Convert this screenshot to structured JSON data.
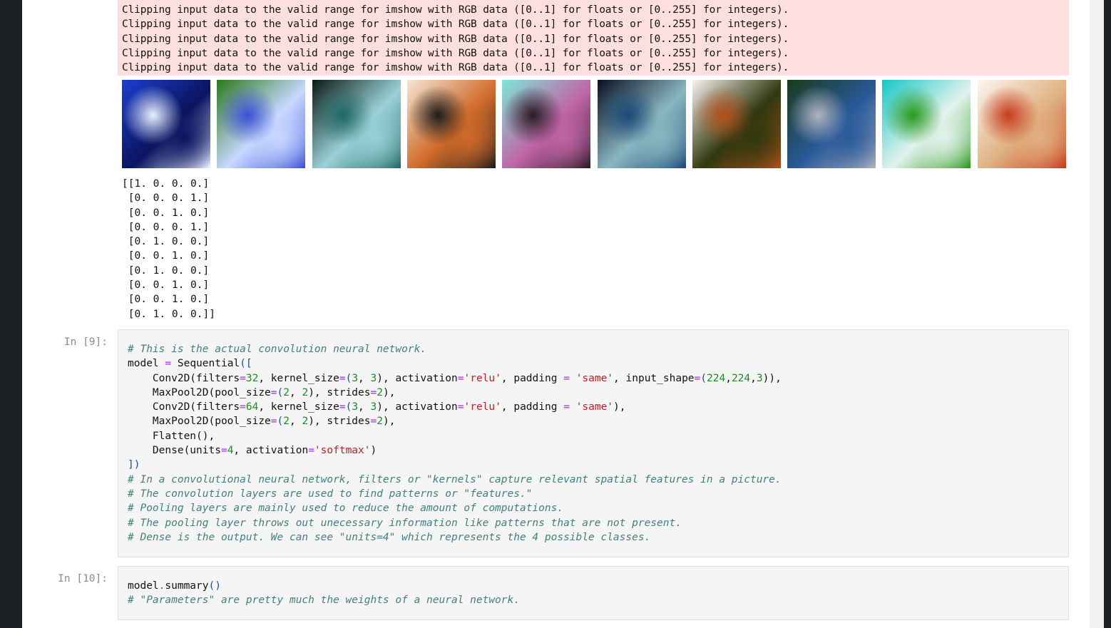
{
  "stderr": {
    "lines": [
      "Clipping input data to the valid range for imshow with RGB data ([0..1] for floats or [0..255] for integers).",
      "Clipping input data to the valid range for imshow with RGB data ([0..1] for floats or [0..255] for integers).",
      "Clipping input data to the valid range for imshow with RGB data ([0..1] for floats or [0..255] for integers).",
      "Clipping input data to the valid range for imshow with RGB data ([0..1] for floats or [0..255] for integers).",
      "Clipping input data to the valid range for imshow with RGB data ([0..1] for floats or [0..255] for integers)."
    ]
  },
  "thumbnails": {
    "count": 10,
    "colors": [
      [
        "#1d3fd0",
        "#e8f0ff",
        "#0a1460"
      ],
      [
        "#2b7a1a",
        "#3a50d8",
        "#c8d8ff"
      ],
      [
        "#0b1a14",
        "#1f6a66",
        "#9ad0d6"
      ],
      [
        "#f4e6d4",
        "#1c1c1c",
        "#d06a2a"
      ],
      [
        "#7de7d8",
        "#2a1a22",
        "#c064a6"
      ],
      [
        "#0a0f20",
        "#1a4a7a",
        "#8ab6c0"
      ],
      [
        "#f6f2ee",
        "#b4501a",
        "#30380f"
      ],
      [
        "#1a3a1a",
        "#b0b4c0",
        "#2a5a9a"
      ],
      [
        "#14c8c8",
        "#2a9a1a",
        "#e2f2ec"
      ],
      [
        "#fbf6f2",
        "#c83a1a",
        "#e0b080"
      ]
    ]
  },
  "labels_output": "[[1. 0. 0. 0.]\n [0. 0. 0. 1.]\n [0. 0. 1. 0.]\n [0. 0. 0. 1.]\n [0. 1. 0. 0.]\n [0. 0. 1. 0.]\n [0. 1. 0. 0.]\n [0. 0. 1. 0.]\n [0. 0. 1. 0.]\n [0. 1. 0. 0.]]",
  "cells": [
    {
      "prompt": "In [9]:",
      "comment_1": "# This is the actual convolution neural network.",
      "t_model": "model",
      "t_eq": "=",
      "t_seq": "Sequential",
      "t_open": "([",
      "l1_a": "    Conv2D(filters",
      "l1_eq": "=",
      "l1_n1": "32",
      "l1_b": ", kernel_size",
      "l1_eq2": "=",
      "l1_c": "(",
      "l1_n2": "3",
      "l1_d": ", ",
      "l1_n3": "3",
      "l1_e": "), activation",
      "l1_eq3": "=",
      "l1_s1": "'relu'",
      "l1_f": ", padding ",
      "l1_eq4": "=",
      "l1_g": " ",
      "l1_s2": "'same'",
      "l1_h": ", input_shape",
      "l1_eq5": "=",
      "l1_i": "(",
      "l1_n4": "224",
      "l1_j": ",",
      "l1_n5": "224",
      "l1_k": ",",
      "l1_n6": "3",
      "l1_l": ")),",
      "l2_a": "    MaxPool2D(pool_size",
      "l2_eq": "=",
      "l2_b": "(",
      "l2_n1": "2",
      "l2_c": ", ",
      "l2_n2": "2",
      "l2_d": "), strides",
      "l2_eq2": "=",
      "l2_n3": "2",
      "l2_e": "),",
      "l3_a": "    Conv2D(filters",
      "l3_eq": "=",
      "l3_n1": "64",
      "l3_b": ", kernel_size",
      "l3_eq2": "=",
      "l3_c": "(",
      "l3_n2": "3",
      "l3_d": ", ",
      "l3_n3": "3",
      "l3_e": "), activation",
      "l3_eq3": "=",
      "l3_s1": "'relu'",
      "l3_f": ", padding ",
      "l3_eq4": "=",
      "l3_g": " ",
      "l3_s2": "'same'",
      "l3_h": "),",
      "l4_a": "    MaxPool2D(pool_size",
      "l4_eq": "=",
      "l4_b": "(",
      "l4_n1": "2",
      "l4_c": ", ",
      "l4_n2": "2",
      "l4_d": "), strides",
      "l4_eq2": "=",
      "l4_n3": "2",
      "l4_e": "),",
      "l5": "    Flatten(),",
      "l6_a": "    Dense(units",
      "l6_eq": "=",
      "l6_n1": "4",
      "l6_b": ", activation",
      "l6_eq2": "=",
      "l6_s1": "'softmax'",
      "l6_c": ")",
      "close": "])",
      "comment_2": "# In a convolutional neural network, filters or \"kernels\" capture relevant spatial features in a picture.",
      "comment_3": "# The convolution layers are used to find patterns or \"features.\"",
      "comment_4": "# Pooling layers are mainly used to reduce the amount of computations.",
      "comment_5": "# The pooling layer throws out unecessary information like patterns that are not present.",
      "comment_6": "# Dense is the output. We can see \"units=4\" which represents the 4 possible classes."
    },
    {
      "prompt": "In [10]:",
      "t_model": "model",
      "t_dot": ".",
      "t_summary": "summary",
      "t_parens": "()",
      "comment_1": "# \"Parameters\" are pretty much the weights of a neural network."
    }
  ]
}
